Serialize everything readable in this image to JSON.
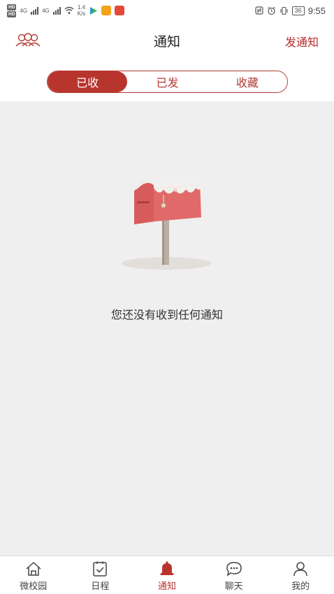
{
  "status_bar": {
    "hd1": "HD",
    "hd2": "HD",
    "net1": "4G",
    "net2": "4G",
    "speed_value": "1.4",
    "speed_unit": "K/s",
    "battery": "36",
    "time": "9:55"
  },
  "header": {
    "title": "通知",
    "action_label": "发通知",
    "left_icon": "contacts-group-icon"
  },
  "segment": {
    "tabs": [
      {
        "label": "已收",
        "active": true
      },
      {
        "label": "已发",
        "active": false
      },
      {
        "label": "收藏",
        "active": false
      }
    ]
  },
  "empty_state": {
    "message": "您还没有收到任何通知",
    "icon": "mailbox-icon"
  },
  "bottom_nav": {
    "items": [
      {
        "label": "微校园",
        "icon": "home-icon",
        "active": false
      },
      {
        "label": "日程",
        "icon": "calendar-check-icon",
        "active": false
      },
      {
        "label": "通知",
        "icon": "bell-icon",
        "active": true
      },
      {
        "label": "聊天",
        "icon": "chat-bubble-icon",
        "active": false
      },
      {
        "label": "我的",
        "icon": "user-icon",
        "active": false
      }
    ]
  },
  "colors": {
    "accent": "#b8352e",
    "background": "#efefef",
    "mailbox": "#e06a6a"
  }
}
